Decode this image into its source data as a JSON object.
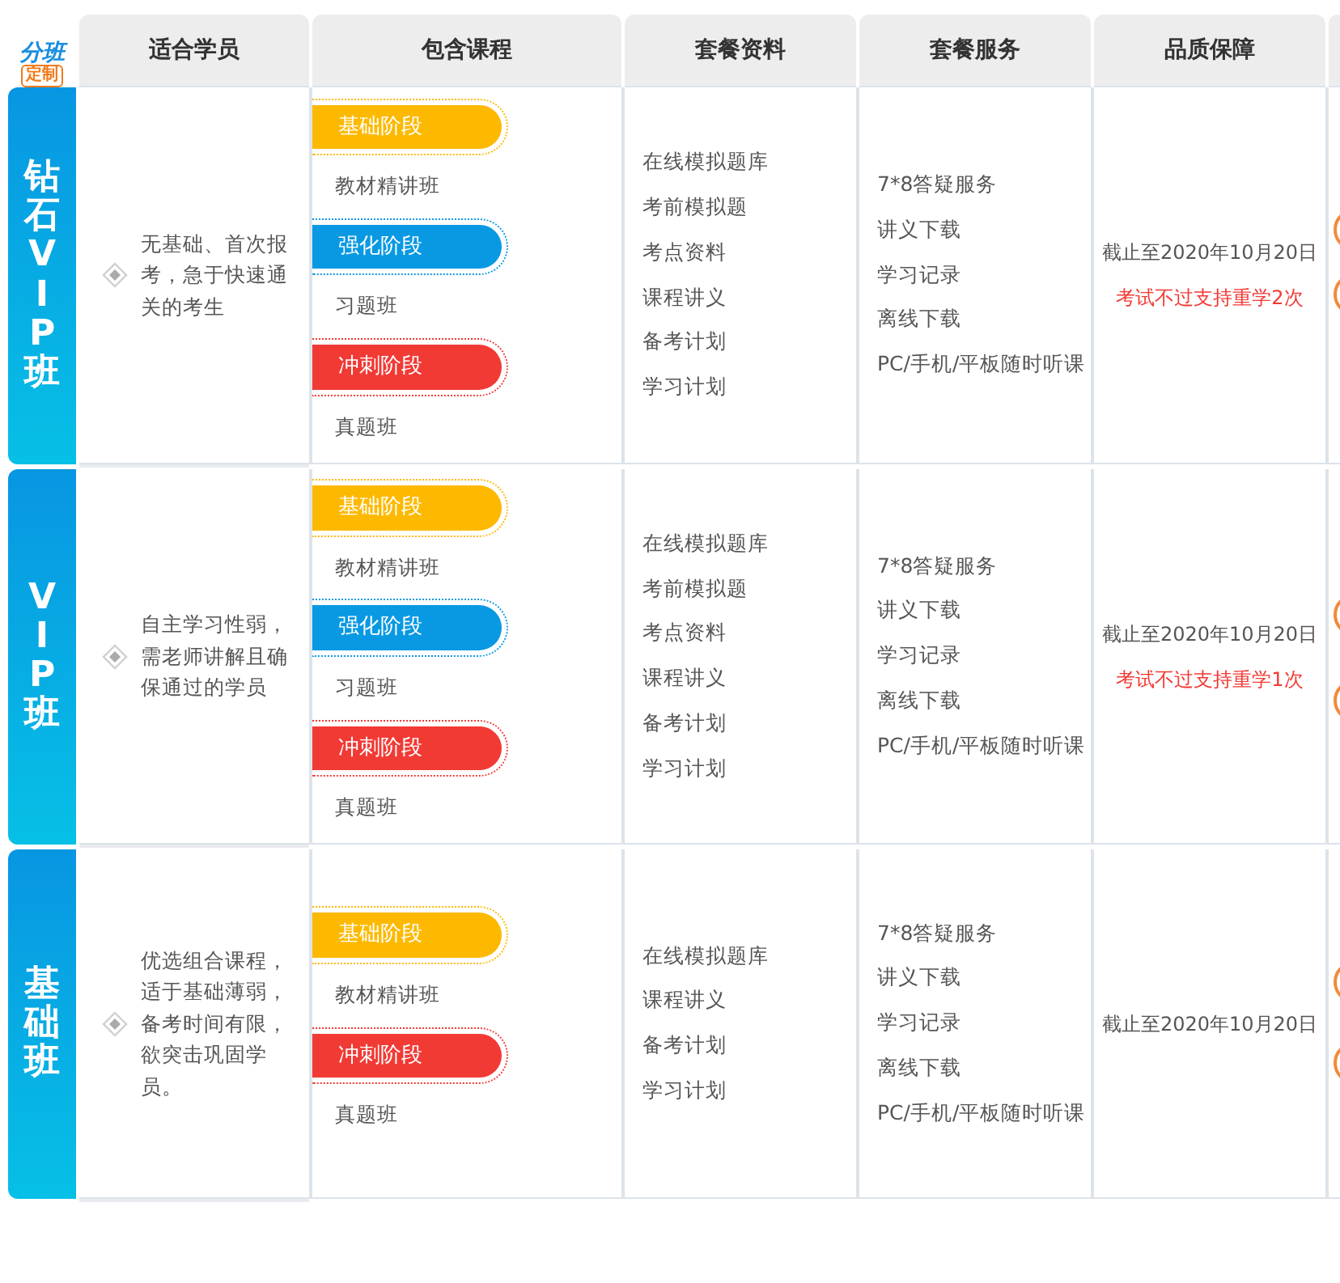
{
  "logo": {
    "title": "分班",
    "badge": "定制"
  },
  "columns": [
    "适合学员",
    "包含课程",
    "套餐资料",
    "套餐服务",
    "品质保障"
  ],
  "rows": [
    {
      "name": "钻石VIP班",
      "audience": "无基础、首次报考，急于快速通关的考生",
      "courses": [
        {
          "stage": "基础阶段",
          "color": "#fdb900",
          "class": "教材精讲班"
        },
        {
          "stage": "强化阶段",
          "color": "#0999e3",
          "class": "习题班"
        },
        {
          "stage": "冲刺阶段",
          "color": "#f23a35",
          "class": "真题班"
        }
      ],
      "materials": [
        "在线模拟题库",
        "考前模拟题",
        "考点资料",
        "课程讲义",
        "备考计划",
        "学习计划"
      ],
      "services": [
        "7*8答疑服务",
        "讲义下载",
        "学习记录",
        "离线下载",
        "PC/手机/平板随时听课"
      ],
      "guarantee": {
        "deadline": "截止至2020年10月20日",
        "retake": "考试不过支持重学2次"
      }
    },
    {
      "name": "VIP班",
      "audience": "自主学习性弱，需老师讲解且确保通过的学员",
      "courses": [
        {
          "stage": "基础阶段",
          "color": "#fdb900",
          "class": "教材精讲班"
        },
        {
          "stage": "强化阶段",
          "color": "#0999e3",
          "class": "习题班"
        },
        {
          "stage": "冲刺阶段",
          "color": "#f23a35",
          "class": "真题班"
        }
      ],
      "materials": [
        "在线模拟题库",
        "考前模拟题",
        "考点资料",
        "课程讲义",
        "备考计划",
        "学习计划"
      ],
      "services": [
        "7*8答疑服务",
        "讲义下载",
        "学习记录",
        "离线下载",
        "PC/手机/平板随时听课"
      ],
      "guarantee": {
        "deadline": "截止至2020年10月20日",
        "retake": "考试不过支持重学1次"
      }
    },
    {
      "name": "基础班",
      "audience": "优选组合课程，适于基础薄弱，备考时间有限，欲突击巩固学员。",
      "courses": [
        {
          "stage": "基础阶段",
          "color": "#fdb900",
          "class": "教材精讲班"
        },
        {
          "stage": "冲刺阶段",
          "color": "#f23a35",
          "class": "真题班"
        }
      ],
      "materials": [
        "在线模拟题库",
        "课程讲义",
        "备考计划",
        "学习计划"
      ],
      "services": [
        "7*8答疑服务",
        "讲义下载",
        "学习记录",
        "离线下载",
        "PC/手机/平板随时听课"
      ],
      "guarantee": {
        "deadline": "截止至2020年10月20日"
      }
    }
  ]
}
